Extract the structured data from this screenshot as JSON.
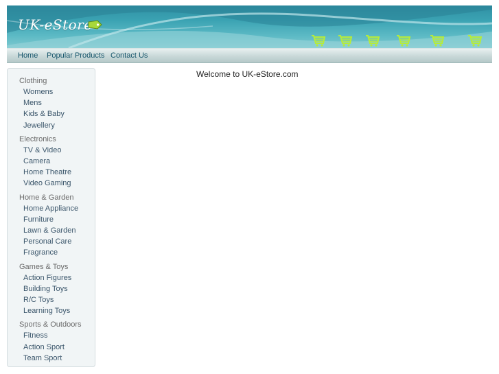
{
  "site": {
    "logo_text": "UK-eStore",
    "accent_color": "#3ba3b3",
    "tag_icon": "price-tag-icon",
    "cart_icon": "shopping-cart-icon"
  },
  "nav": {
    "items": [
      {
        "label": "Home"
      },
      {
        "label": "Popular Products"
      },
      {
        "label": "Contact Us"
      }
    ]
  },
  "sidebar": {
    "categories": [
      {
        "label": "Clothing",
        "items": [
          "Womens",
          "Mens",
          "Kids & Baby",
          "Jewellery"
        ]
      },
      {
        "label": "Electronics",
        "items": [
          "TV & Video",
          "Camera",
          "Home Theatre",
          "Video Gaming"
        ]
      },
      {
        "label": "Home & Garden",
        "items": [
          "Home Appliance",
          "Furniture",
          "Lawn & Garden",
          "Personal Care",
          "Fragrance"
        ]
      },
      {
        "label": "Games & Toys",
        "items": [
          "Action Figures",
          "Building Toys",
          "R/C Toys",
          "Learning Toys"
        ]
      },
      {
        "label": "Sports & Outdoors",
        "items": [
          "Fitness",
          "Action Sport",
          "Team Sport"
        ]
      }
    ]
  },
  "main": {
    "welcome": "Welcome to UK-eStore.com"
  }
}
